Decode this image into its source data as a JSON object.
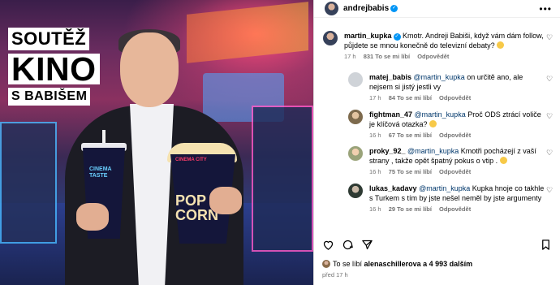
{
  "photo": {
    "promo_line1": "SOUTĚŽ",
    "promo_line2": "KINO",
    "promo_line3": "S BABIŠEM",
    "cup_text": "CINEMA TASTE",
    "corn_brand": "CINEMA CITY",
    "corn_text": "POP CORN"
  },
  "post": {
    "author": "andrejbabis",
    "more_icon": "more-horizontal-icon"
  },
  "comments": [
    {
      "user": "martin_kupka",
      "verified": true,
      "text": "Kmotr. Andreji Babiši, když vám dám follow, půjdete se mnou konečně do televizní debaty?",
      "emoji": true,
      "time": "17 h",
      "likes": "831 To se mi líbí",
      "reply": "Odpovědět"
    },
    {
      "user": "matej_babis",
      "mention": "@martin_kupka",
      "text": " on určitě ano, ale nejsem si jistý jestli vy",
      "time": "17 h",
      "likes": "84 To se mi líbí",
      "reply": "Odpovědět"
    },
    {
      "user": "fightman_47",
      "mention": "@martin_kupka",
      "text": " Proč ODS ztrácí voliče je klíčová otazka?",
      "emoji": true,
      "time": "16 h",
      "likes": "67 To se mi líbí",
      "reply": "Odpovědět"
    },
    {
      "user": "proky_92_",
      "mention": "@martin_kupka",
      "text": " Kmotři pocházejí z vaší strany , takže opět špatný pokus o vtip .",
      "emoji": true,
      "time": "16 h",
      "likes": "75 To se mi líbí",
      "reply": "Odpovědět"
    },
    {
      "user": "lukas_kadavy",
      "mention": "@martin_kupka",
      "text": " Kupka hnoje co takhle s Turkem s tím by jste nešel nemĕl by jste argumenty",
      "time": "16 h",
      "likes": "29 To se mi líbí",
      "reply": "Odpovědět"
    }
  ],
  "actions": {
    "like_icon": "heart-icon",
    "comment_icon": "comment-icon",
    "share_icon": "share-icon",
    "save_icon": "bookmark-icon"
  },
  "likes_line": {
    "prefix": "To se líbí",
    "user": "alenaschillerova",
    "suffix": "a 4 993 dalším"
  },
  "posted_ago": "před 17 h"
}
